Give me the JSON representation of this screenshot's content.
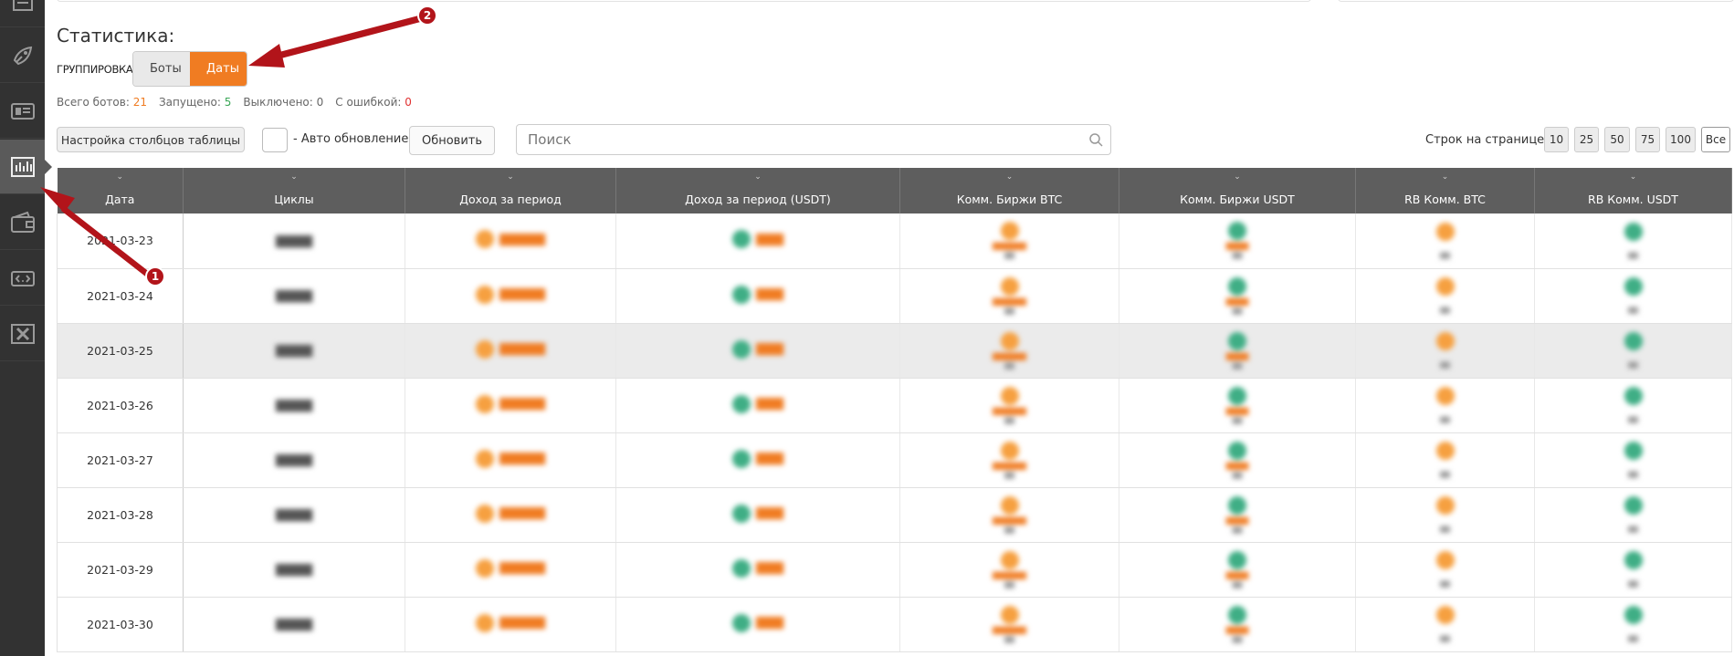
{
  "sidebar": {
    "items": [
      {
        "icon": "monitor-icon"
      },
      {
        "icon": "rocket-icon"
      },
      {
        "icon": "news-icon"
      },
      {
        "icon": "bar-chart-icon",
        "active": true
      },
      {
        "icon": "wallet-icon"
      },
      {
        "icon": "code-icon"
      },
      {
        "icon": "tools-icon"
      }
    ]
  },
  "page": {
    "title": "Статистика:",
    "grouping_label": "ГРУППИРОВКА",
    "group_bots": "Боты",
    "group_dates": "Даты"
  },
  "stats": {
    "total_label": "Всего ботов:",
    "total_value": "21",
    "running_label": "Запущено:",
    "running_value": "5",
    "off_label": "Выключено:",
    "off_value": "0",
    "error_label": "С ошибкой:",
    "error_value": "0"
  },
  "toolbar": {
    "columns_button": "Настройка столбцов таблицы",
    "auto_update_label": "- Авто обновление",
    "refresh_button": "Обновить",
    "search_placeholder": "Поиск",
    "rows_per_page_label": "Строк на странице",
    "rows_per_page_options": [
      "10",
      "25",
      "50",
      "75",
      "100",
      "Все"
    ],
    "rows_per_page_selected": "Все"
  },
  "table": {
    "columns": [
      "Дата",
      "Циклы",
      "Доход за период",
      "Доход за период (USDT)",
      "Комм. Биржи BTC",
      "Комм. Биржи USDT",
      "RB Комм. BTC",
      "RB Комм. USDT"
    ],
    "rows": [
      {
        "date": "2021-03-23"
      },
      {
        "date": "2021-03-24"
      },
      {
        "date": "2021-03-25",
        "highlight": true
      },
      {
        "date": "2021-03-26"
      },
      {
        "date": "2021-03-27"
      },
      {
        "date": "2021-03-28"
      },
      {
        "date": "2021-03-29"
      },
      {
        "date": "2021-03-30"
      }
    ]
  },
  "annotations": {
    "badge_1": "1",
    "badge_2": "2"
  },
  "colors": {
    "accent": "#f07c22",
    "sidebar": "#323232",
    "header": "#5e5e5e",
    "annotation": "#b2141a"
  }
}
